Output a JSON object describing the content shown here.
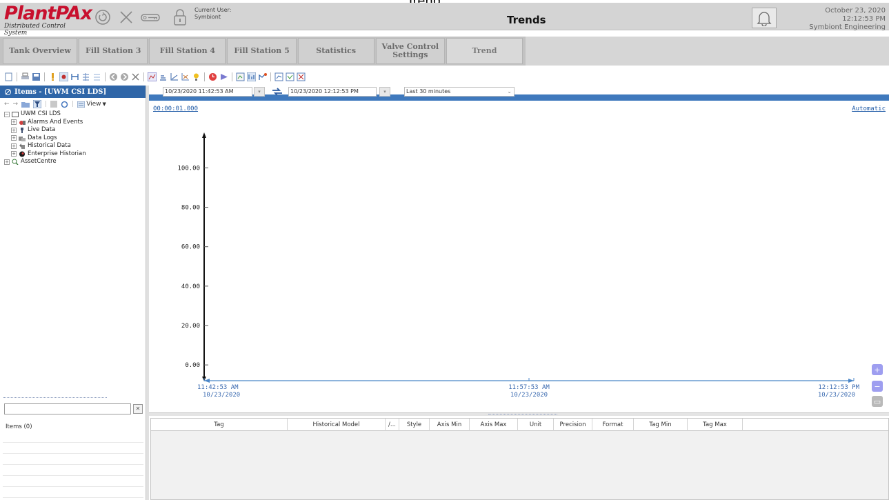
{
  "window_title": "Trend",
  "header": {
    "logo_text": "PlantPAx",
    "logo_tagline": "Distributed Control System",
    "current_user_label": "Current User:",
    "current_user_value": "Symbiont",
    "page_title": "Trends",
    "date": "October 23, 2020",
    "time": "12:12:53 PM",
    "company": "Symbiont Engineering"
  },
  "nav_tabs": [
    {
      "label": "Tank Overview"
    },
    {
      "label": "Fill Station 3"
    },
    {
      "label": "Fill Station 4"
    },
    {
      "label": "Fill Station 5"
    },
    {
      "label": "Statistics"
    },
    {
      "label": "Valve Control Settings"
    },
    {
      "label": "Trend"
    }
  ],
  "left_panel": {
    "title": "Items - [UWM CSI LDS]",
    "view_label": "View",
    "tree": [
      {
        "label": "UWM CSI LDS",
        "level": 0,
        "icon": "folder-icon",
        "expander": "−"
      },
      {
        "label": "Alarms And Events",
        "level": 1,
        "icon": "alarm-events-icon",
        "expander": "+"
      },
      {
        "label": "Live Data",
        "level": 1,
        "icon": "live-data-icon",
        "expander": "+"
      },
      {
        "label": "Data Logs",
        "level": 1,
        "icon": "data-logs-icon",
        "expander": "+"
      },
      {
        "label": "Historical Data",
        "level": 1,
        "icon": "historical-data-icon",
        "expander": "+"
      },
      {
        "label": "Enterprise Historian",
        "level": 1,
        "icon": "enterprise-historian-icon",
        "expander": "+"
      },
      {
        "label": "AssetCentre",
        "level": 0,
        "icon": "asset-centre-icon",
        "expander": "+"
      }
    ],
    "filter_placeholder": "",
    "items_count_label": "Items (0)"
  },
  "controls": {
    "start_time": "10/23/2020 11:42:53 AM",
    "end_time": "10/23/2020 12:12:53 PM",
    "range_select": "Last 30 minutes",
    "duration": "00:00:01.000",
    "mode": "Automatic"
  },
  "chart_data": {
    "type": "line",
    "series": [],
    "yticks": [
      0,
      20,
      40,
      60,
      80,
      100
    ],
    "ytick_labels": [
      "0.00",
      "20.00",
      "40.00",
      "60.00",
      "80.00",
      "100.00"
    ],
    "ylim": [
      -8,
      118
    ],
    "xticks": [
      {
        "time": "11:42:53 AM",
        "date": "10/23/2020"
      },
      {
        "time": "11:57:53 AM",
        "date": "10/23/2020"
      },
      {
        "time": "12:12:53 PM",
        "date": "10/23/2020"
      }
    ],
    "xlim": [
      "10/23/2020 11:42:53 AM",
      "10/23/2020 12:12:53 PM"
    ],
    "axis_color": "#4a86c8",
    "grid": false
  },
  "zoom_buttons": [
    {
      "label": "+",
      "color": "#9e9ef0"
    },
    {
      "label": "−",
      "color": "#9e9ef0"
    },
    {
      "label": "▭",
      "color": "#b9b9b9"
    }
  ],
  "grid_table": {
    "columns": [
      "Tag",
      "Historical Model",
      "/...",
      "Style",
      "Axis Min",
      "Axis Max",
      "Unit",
      "Precision",
      "Format",
      "Tag Min",
      "Tag Max"
    ],
    "rows": []
  },
  "colors": {
    "header_bg": "#d4d4d4",
    "panel_header": "#2f66a8",
    "logo_red": "#c8102e",
    "link_blue": "#1f5aa6"
  }
}
